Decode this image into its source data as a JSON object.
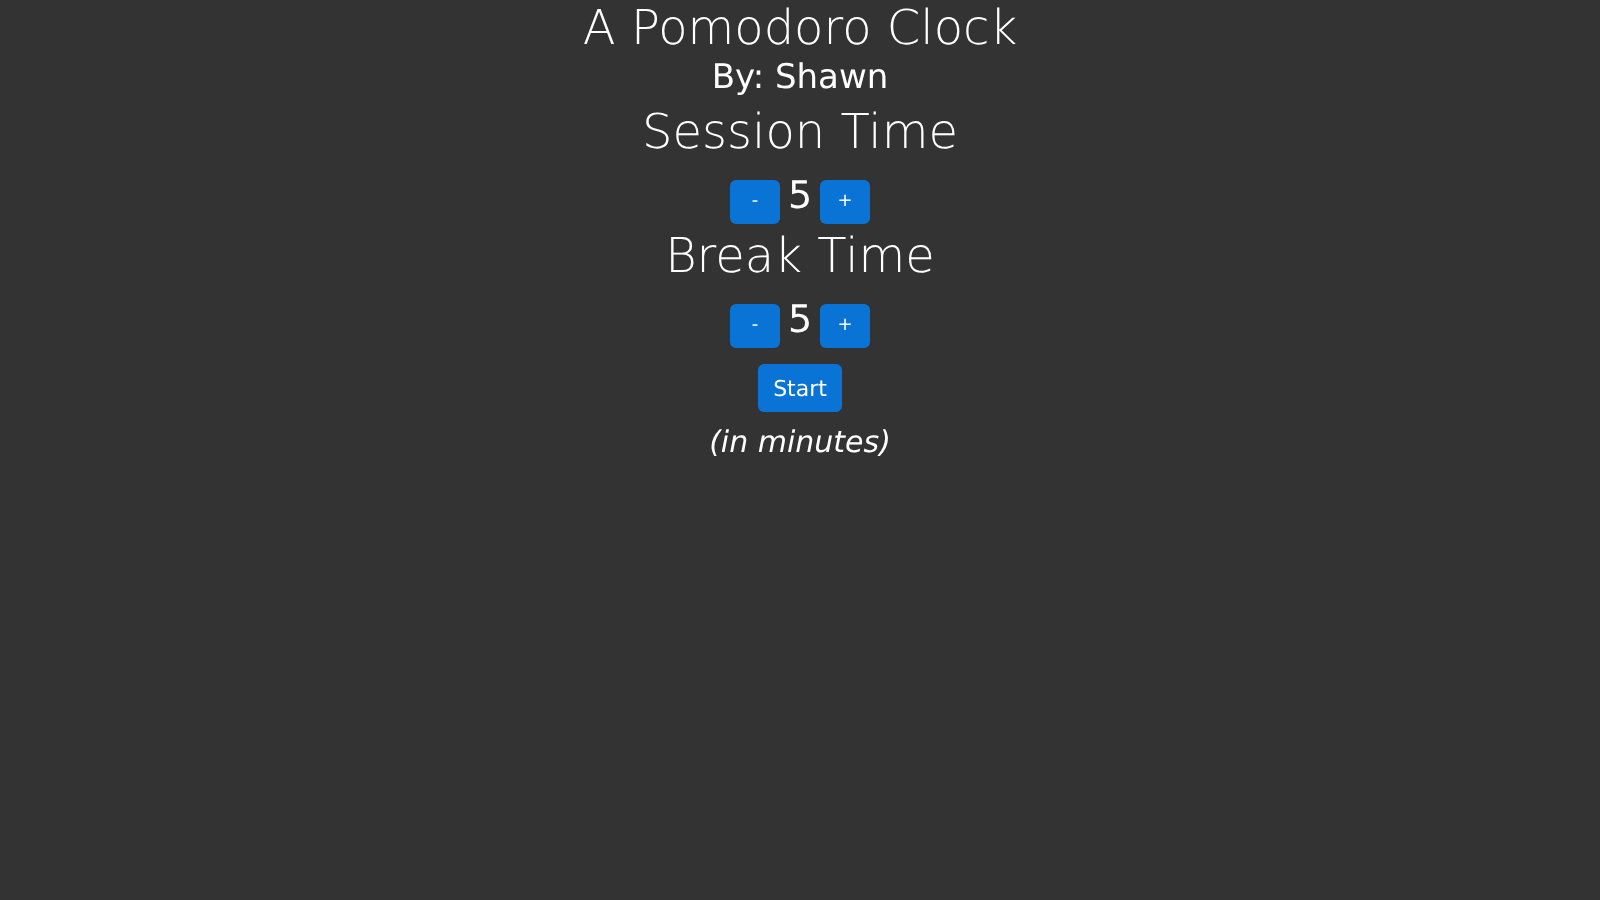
{
  "title": "A Pomodoro Clock",
  "author": "By: Shawn",
  "settings": [
    {
      "label": "Session Time",
      "decrement": "-",
      "value": "5",
      "increment": "+"
    },
    {
      "label": "Break Time",
      "decrement": "-",
      "value": "5",
      "increment": "+"
    }
  ],
  "start_button": "Start",
  "note": "(in minutes)"
}
